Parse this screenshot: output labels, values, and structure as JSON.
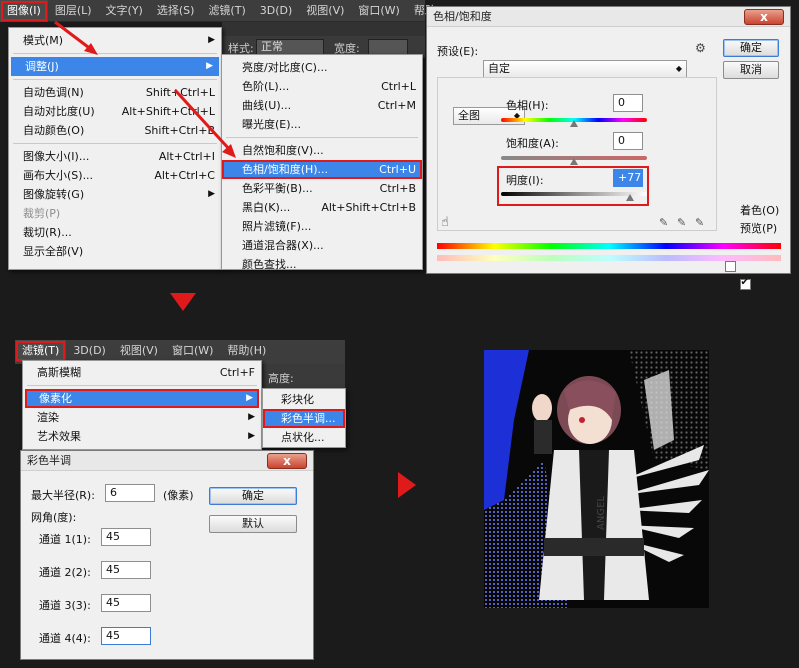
{
  "top_menubar": {
    "items": [
      "图像(I)",
      "图层(L)",
      "文字(Y)",
      "选择(S)",
      "滤镜(T)",
      "3D(D)",
      "视图(V)",
      "窗口(W)",
      "帮助"
    ]
  },
  "options_bar": {
    "style_label": "样式:",
    "style_value": "正常",
    "width_label": "宽度:"
  },
  "image_menu": {
    "items": [
      {
        "label": "模式(M)",
        "shortcut": "",
        "arrow": true
      },
      {
        "label": "调整(J)",
        "shortcut": "",
        "arrow": true
      },
      {
        "label": "自动色调(N)",
        "shortcut": "Shift+Ctrl+L"
      },
      {
        "label": "自动对比度(U)",
        "shortcut": "Alt+Shift+Ctrl+L"
      },
      {
        "label": "自动颜色(O)",
        "shortcut": "Shift+Ctrl+B"
      },
      {
        "label": "图像大小(I)...",
        "shortcut": "Alt+Ctrl+I"
      },
      {
        "label": "画布大小(S)...",
        "shortcut": "Alt+Ctrl+C"
      },
      {
        "label": "图像旋转(G)",
        "shortcut": "",
        "arrow": true
      },
      {
        "label": "裁剪(P)",
        "shortcut": ""
      },
      {
        "label": "裁切(R)...",
        "shortcut": ""
      },
      {
        "label": "显示全部(V)",
        "shortcut": ""
      }
    ]
  },
  "adjust_menu": {
    "items": [
      {
        "label": "亮度/对比度(C)...",
        "shortcut": ""
      },
      {
        "label": "色阶(L)...",
        "shortcut": "Ctrl+L"
      },
      {
        "label": "曲线(U)...",
        "shortcut": "Ctrl+M"
      },
      {
        "label": "曝光度(E)...",
        "shortcut": ""
      },
      {
        "label": "自然饱和度(V)...",
        "shortcut": ""
      },
      {
        "label": "色相/饱和度(H)...",
        "shortcut": "Ctrl+U"
      },
      {
        "label": "色彩平衡(B)...",
        "shortcut": "Ctrl+B"
      },
      {
        "label": "黑白(K)...",
        "shortcut": "Alt+Shift+Ctrl+B"
      },
      {
        "label": "照片滤镜(F)...",
        "shortcut": ""
      },
      {
        "label": "通道混合器(X)...",
        "shortcut": ""
      },
      {
        "label": "颜色查找...",
        "shortcut": ""
      }
    ]
  },
  "hue_sat_dialog": {
    "title": "色相/饱和度",
    "close": "x",
    "preset_label": "预设(E):",
    "preset_value": "自定",
    "ok": "确定",
    "cancel": "取消",
    "channel_value": "全图",
    "hue_label": "色相(H):",
    "hue_value": "0",
    "sat_label": "饱和度(A):",
    "sat_value": "0",
    "light_label": "明度(I):",
    "light_value": "+77",
    "colorize_label": "着色(O)",
    "preview_label": "预览(P)",
    "hue_level": 0.5,
    "sat_level": 0.5,
    "light_level": 0.885
  },
  "bottom_menubar": {
    "items": [
      "滤镜(T)",
      "3D(D)",
      "视图(V)",
      "窗口(W)",
      "帮助(H)"
    ]
  },
  "bottom_options": {
    "height_label": "高度:"
  },
  "filter_menu": {
    "items": [
      {
        "label": "高斯模糊",
        "shortcut": "Ctrl+F"
      },
      {
        "label": "像素化",
        "shortcut": "",
        "arrow": true
      },
      {
        "label": "渲染",
        "shortcut": "",
        "arrow": true
      },
      {
        "label": "艺术效果",
        "shortcut": "",
        "arrow": true
      }
    ]
  },
  "pixelate_menu": {
    "items": [
      {
        "label": "彩块化"
      },
      {
        "label": "彩色半调..."
      },
      {
        "label": "点状化..."
      }
    ]
  },
  "halftone_dialog": {
    "title": "彩色半调",
    "close": "x",
    "radius_label": "最大半径(R):",
    "radius_value": "6",
    "radius_unit": "(像素)",
    "angles_label": "网角(度):",
    "ok": "确定",
    "reset": "默认",
    "channels": [
      {
        "label": "通道 1(1):",
        "value": "45"
      },
      {
        "label": "通道 2(2):",
        "value": "45"
      },
      {
        "label": "通道 3(3):",
        "value": "45"
      },
      {
        "label": "通道 4(4):",
        "value": "45"
      }
    ]
  },
  "result_image": {
    "caption": "ANGEL"
  },
  "colors": {
    "highlight_red": "#e01a1a",
    "menu_select_blue": "#3b86e8",
    "accent_arrow": "#e01a1a"
  }
}
